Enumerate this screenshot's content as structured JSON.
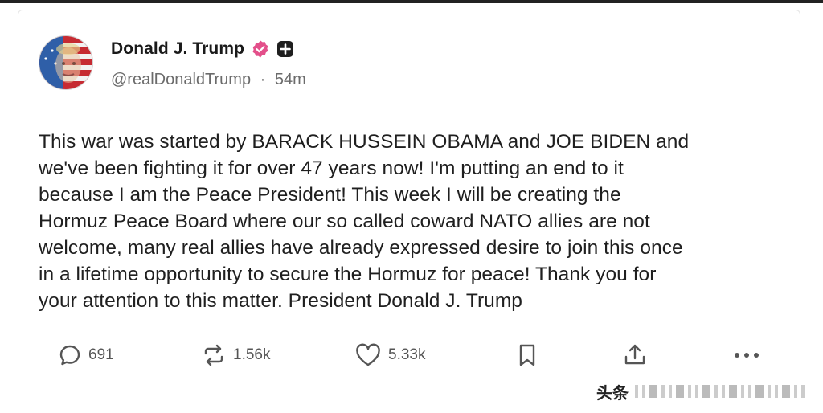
{
  "post": {
    "author": {
      "display_name": "Donald J. Trump",
      "handle": "@realDonaldTrump",
      "separator": "·",
      "time": "54m",
      "verified_badge_color": "#e34f8a"
    },
    "body_lines": [
      "This war was started by BARACK HUSSEIN OBAMA and JOE BIDEN and",
      "we've been fighting it for over 47 years now! I'm putting an end to it",
      "because I am the Peace President! This week I will be creating the",
      "Hormuz Peace Board where our so called coward NATO allies are not",
      "welcome, many real allies have already expressed desire to join this once",
      "in a lifetime opportunity to secure the Hormuz for peace! Thank you for",
      "your attention to this matter. President Donald J. Trump"
    ]
  },
  "actions": {
    "replies": {
      "icon": "reply-icon",
      "count": "691"
    },
    "retruths": {
      "icon": "retruth-icon",
      "count": "1.56k"
    },
    "likes": {
      "icon": "heart-icon",
      "count": "5.33k"
    },
    "bookmark": {
      "icon": "bookmark-icon"
    },
    "share": {
      "icon": "share-icon"
    },
    "more": {
      "icon": "more-icon"
    }
  },
  "watermark": {
    "text": "头条"
  }
}
